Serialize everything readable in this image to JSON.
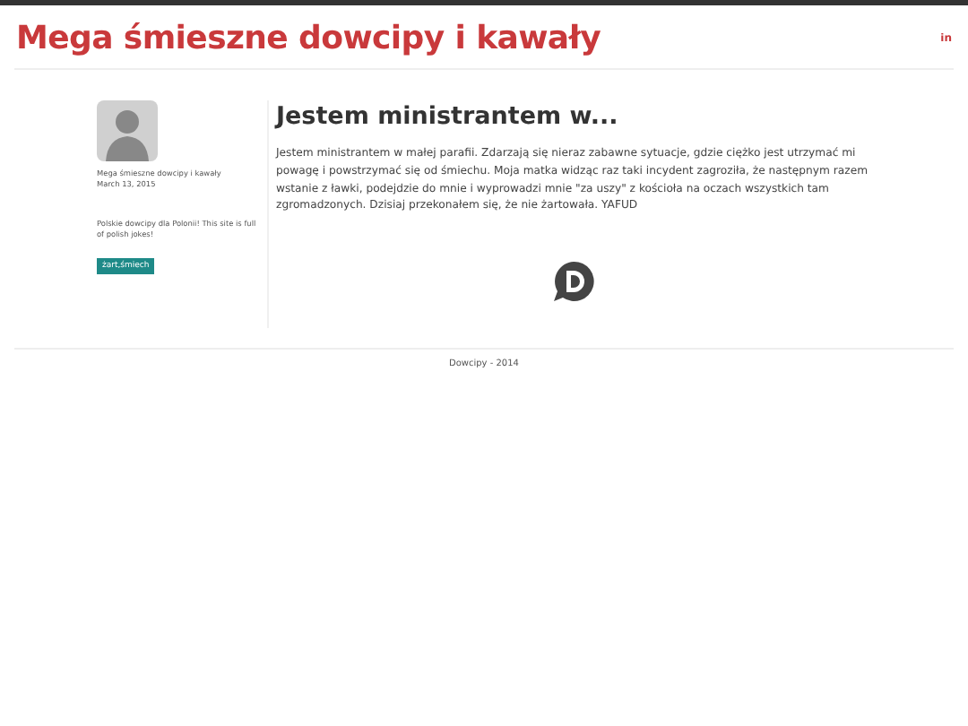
{
  "header": {
    "title": "Mega śmieszne dowcipy i kawały",
    "social_link": "in"
  },
  "sidebar": {
    "author": "Mega śmieszne dowcipy i kawały",
    "date": "March 13, 2015",
    "description": "Polskie dowcipy dla Polonii! This site is full of polish jokes!",
    "tags": [
      "żart,śmiech"
    ]
  },
  "post": {
    "title": "Jestem ministrantem w...",
    "body": "Jestem ministrantem w małej parafii. Zdarzają się nieraz zabawne sytuacje, gdzie ciężko jest utrzymać mi powagę i powstrzymać się od śmiechu. Moja matka widząc raz taki incydent zagroziła, że następnym razem wstanie z ławki, podejdzie do mnie i wyprowadzi mnie \"za uszy\" z kościoła na oczach wszystkich tam zgromadzonych. Dzisiaj przekonałem się, że nie żartowała. YAFUD"
  },
  "footer": {
    "text": "Dowcipy - 2014"
  }
}
